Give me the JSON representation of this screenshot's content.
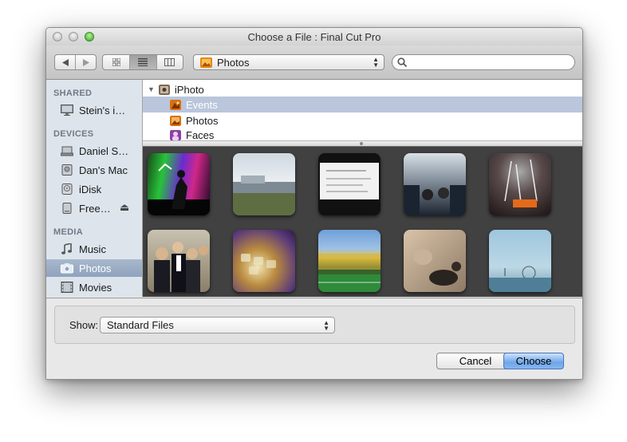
{
  "window": {
    "title": "Choose a File : Final Cut Pro"
  },
  "toolbar": {
    "location_label": "Photos",
    "search_placeholder": ""
  },
  "sidebar": {
    "sections": [
      {
        "header": "SHARED",
        "items": [
          {
            "label": "Stein's i…",
            "icon": "display-icon"
          }
        ]
      },
      {
        "header": "DEVICES",
        "items": [
          {
            "label": "Daniel S…",
            "icon": "laptop-icon"
          },
          {
            "label": "Dan's Mac",
            "icon": "hard-drive-icon"
          },
          {
            "label": "iDisk",
            "icon": "idisk-icon"
          },
          {
            "label": "Free…",
            "icon": "external-drive-icon",
            "eject": "⏏"
          }
        ]
      },
      {
        "header": "MEDIA",
        "items": [
          {
            "label": "Music",
            "icon": "music-note-icon"
          },
          {
            "label": "Photos",
            "icon": "camera-icon",
            "selected": true
          },
          {
            "label": "Movies",
            "icon": "film-icon"
          }
        ]
      }
    ]
  },
  "tree": {
    "root": {
      "label": "iPhoto",
      "expanded": true
    },
    "children": [
      {
        "label": "Events",
        "selected": true
      },
      {
        "label": "Photos"
      },
      {
        "label": "Faces"
      }
    ]
  },
  "thumbnails": [
    "concert-photo",
    "building-photo",
    "document-photo",
    "bus-interior-photo",
    "fireworks-photo",
    "group-photo",
    "keyboard-photo",
    "stadium-photo",
    "cat-photo",
    "ferris-wheel-photo"
  ],
  "bottom": {
    "show_label": "Show:",
    "show_value": "Standard Files",
    "cancel_label": "Cancel",
    "choose_label": "Choose"
  },
  "colors": {
    "selection": "#bac6db",
    "sidebar_bg": "#dde4ec",
    "grid_bg": "#414141",
    "primary_button": "#6fa6ea"
  }
}
